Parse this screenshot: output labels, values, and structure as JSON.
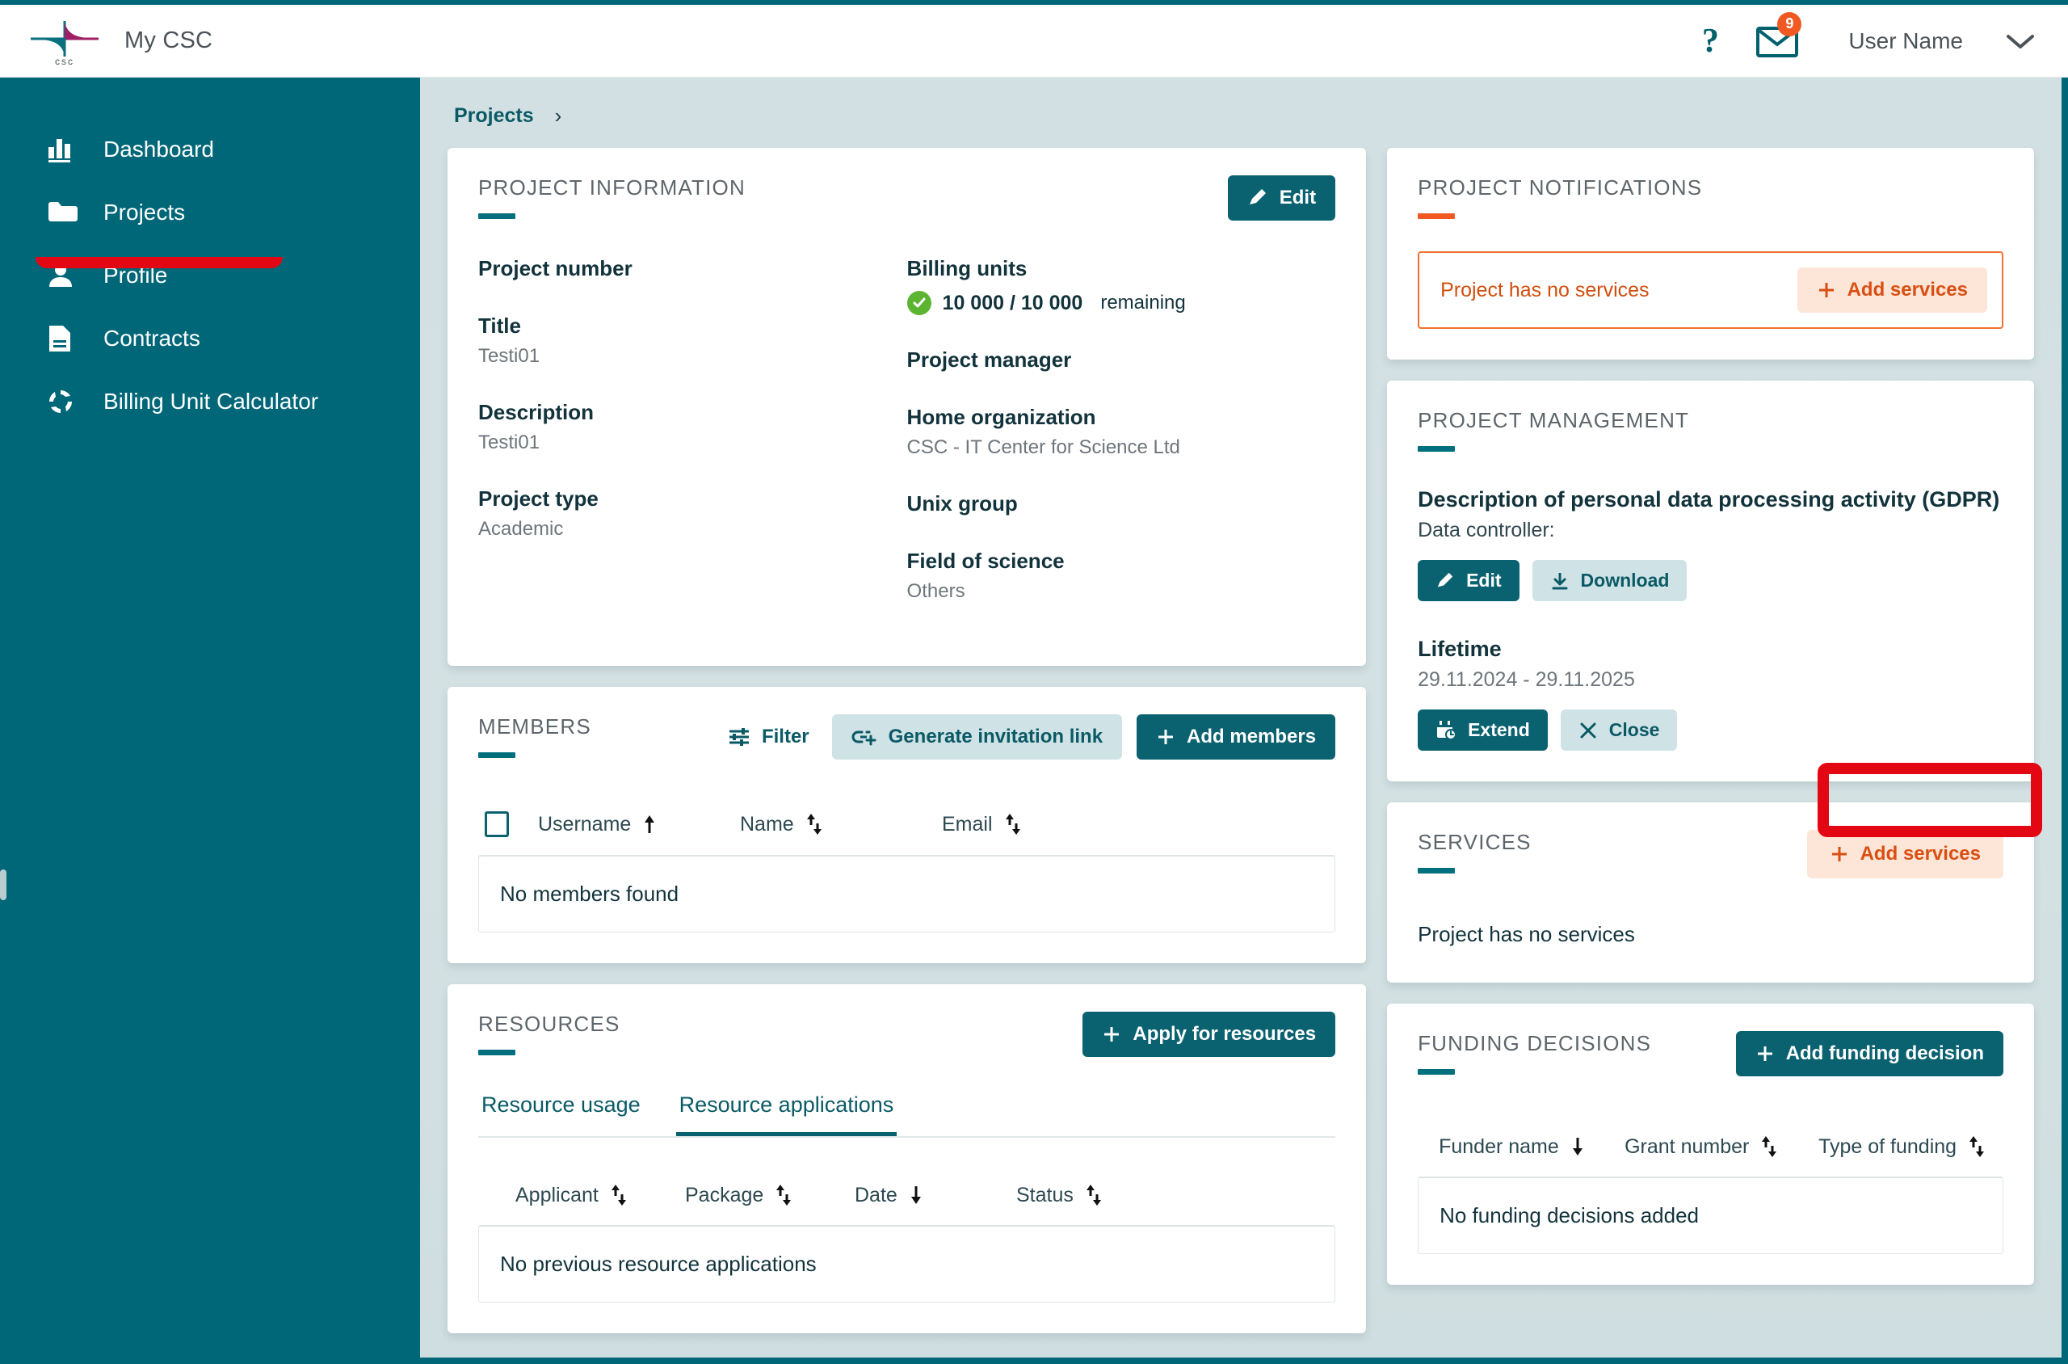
{
  "header": {
    "brand_title": "My CSC",
    "help_icon": "question-mark-icon",
    "mail_icon": "envelope-icon",
    "mail_badge_count": "9",
    "user_name": "User Name",
    "chevron_icon": "chevron-down-icon"
  },
  "sidebar": {
    "items": [
      {
        "label": "Dashboard",
        "icon": "bar-chart-icon"
      },
      {
        "label": "Projects",
        "icon": "folder-icon"
      },
      {
        "label": "Profile",
        "icon": "person-icon"
      },
      {
        "label": "Contracts",
        "icon": "document-icon"
      },
      {
        "label": "Billing Unit Calculator",
        "icon": "refresh-circle-icon"
      }
    ]
  },
  "breadcrumb": {
    "root": "Projects",
    "separator": "›"
  },
  "project_information": {
    "title": "PROJECT INFORMATION",
    "edit_label": "Edit",
    "fields": {
      "project_number_label": "Project number",
      "project_number_value": "",
      "title_label": "Title",
      "title_value": "Testi01",
      "description_label": "Description",
      "description_value": "Testi01",
      "project_type_label": "Project type",
      "project_type_value": "Academic",
      "billing_units_label": "Billing units",
      "billing_units_value": "10 000 / 10 000",
      "billing_units_suffix": "remaining",
      "project_manager_label": "Project manager",
      "project_manager_value": "",
      "home_organization_label": "Home organization",
      "home_organization_value": "CSC - IT Center for Science Ltd",
      "unix_group_label": "Unix group",
      "unix_group_value": "",
      "field_of_science_label": "Field of science",
      "field_of_science_value": "Others"
    }
  },
  "members": {
    "title": "MEMBERS",
    "filter_label": "Filter",
    "generate_link_label": "Generate invitation link",
    "add_members_label": "Add members",
    "columns": [
      "Username",
      "Name",
      "Email"
    ],
    "empty_text": "No members found"
  },
  "resources": {
    "title": "RESOURCES",
    "apply_label": "Apply for resources",
    "tabs": [
      {
        "label": "Resource usage",
        "active": false
      },
      {
        "label": "Resource applications",
        "active": true
      }
    ],
    "columns": [
      "Applicant",
      "Package",
      "Date",
      "Status"
    ],
    "empty_text": "No previous resource applications"
  },
  "project_notifications": {
    "title": "PROJECT NOTIFICATIONS",
    "message": "Project has no services",
    "add_services_label": "Add services"
  },
  "project_management": {
    "title": "PROJECT MANAGEMENT",
    "gdpr_title": "Description of personal data processing activity (GDPR)",
    "data_controller_label": "Data controller:",
    "edit_label": "Edit",
    "download_label": "Download",
    "lifetime_label": "Lifetime",
    "lifetime_value": "29.11.2024 - 29.11.2025",
    "extend_label": "Extend",
    "close_label": "Close"
  },
  "services": {
    "title": "SERVICES",
    "add_services_label": "Add services",
    "empty_text": "Project has no services"
  },
  "funding_decisions": {
    "title": "FUNDING DECISIONS",
    "add_label": "Add funding decision",
    "columns": [
      "Funder name",
      "Grant number",
      "Type of funding"
    ],
    "empty_text": "No funding decisions added"
  },
  "colors": {
    "teal": "#006778",
    "teal_dark": "#0a6170",
    "orange": "#f05a22",
    "annotation_red": "#e30613",
    "page_bg": "#d3e0e3"
  }
}
